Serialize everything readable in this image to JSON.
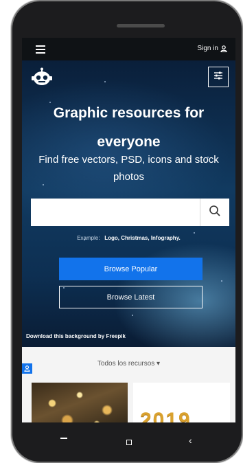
{
  "topbar": {
    "signin_label": "Sign in"
  },
  "hero": {
    "headline_line1": "Graphic resources for",
    "headline_line2": "everyone",
    "subhead": "Find free vectors, PSD, icons and stock photos",
    "search": {
      "value": "",
      "placeholder": ""
    },
    "example_label": "Example:",
    "example_terms": "Logo, Christmas, Infography.",
    "browse_popular": "Browse Popular",
    "browse_latest": "Browse Latest",
    "credit": "Download this background by Freepik"
  },
  "lower": {
    "resources_dropdown": "Todos los recursos ▾",
    "thumb2_text": "2019"
  },
  "icons": {
    "menu": "hamburger-icon",
    "user": "user-icon",
    "mascot": "freepik-mascot-icon",
    "filters": "sliders-icon",
    "search": "search-icon",
    "nav_back": "back-line-icon",
    "nav_home": "square-icon",
    "nav_recent": "chevron-left-icon"
  },
  "colors": {
    "accent": "#1273eb",
    "topbar": "#0f1215",
    "hero": "#0d2f52"
  }
}
